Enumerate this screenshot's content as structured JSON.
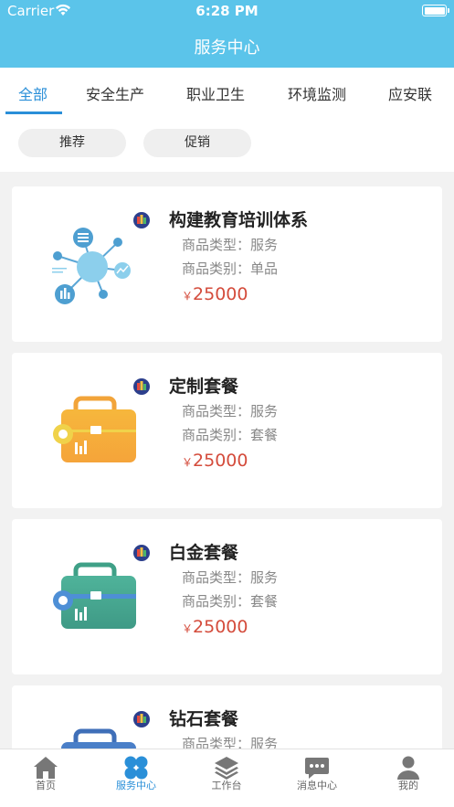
{
  "status_bar": {
    "carrier": "Carrier",
    "time": "6:28 PM"
  },
  "nav": {
    "title": "服务中心"
  },
  "tabs": [
    {
      "label": "全部",
      "active": true
    },
    {
      "label": "安全生产",
      "active": false
    },
    {
      "label": "职业卫生",
      "active": false
    },
    {
      "label": "环境监测",
      "active": false
    },
    {
      "label": "应安联",
      "active": false
    }
  ],
  "chips": [
    {
      "label": "推荐"
    },
    {
      "label": "促销"
    }
  ],
  "cards": [
    {
      "title": "构建教育培训体系",
      "type": "商品类型：服务",
      "category": "商品类别：单品",
      "currency": "￥",
      "price": "25000",
      "image": "network-diagram-icon"
    },
    {
      "title": "定制套餐",
      "type": "商品类型：服务",
      "category": "商品类别：套餐",
      "currency": "￥",
      "price": "25000",
      "image": "orange-briefcase-icon"
    },
    {
      "title": "白金套餐",
      "type": "商品类型：服务",
      "category": "商品类别：套餐",
      "currency": "￥",
      "price": "25000",
      "image": "green-briefcase-icon"
    },
    {
      "title": "钻石套餐",
      "type": "商品类型：服务",
      "category": "",
      "currency": "",
      "price": "",
      "image": "blue-briefcase-icon"
    }
  ],
  "tabbar": [
    {
      "label": "首页",
      "icon": "home-icon",
      "active": false
    },
    {
      "label": "服务中心",
      "icon": "service-center-icon",
      "active": true
    },
    {
      "label": "工作台",
      "icon": "layers-icon",
      "active": false
    },
    {
      "label": "消息中心",
      "icon": "message-icon",
      "active": false
    },
    {
      "label": "我的",
      "icon": "person-icon",
      "active": false
    }
  ],
  "colors": {
    "accent": "#2a8fd8",
    "header": "#5bc4ea",
    "price": "#d44c3c"
  }
}
